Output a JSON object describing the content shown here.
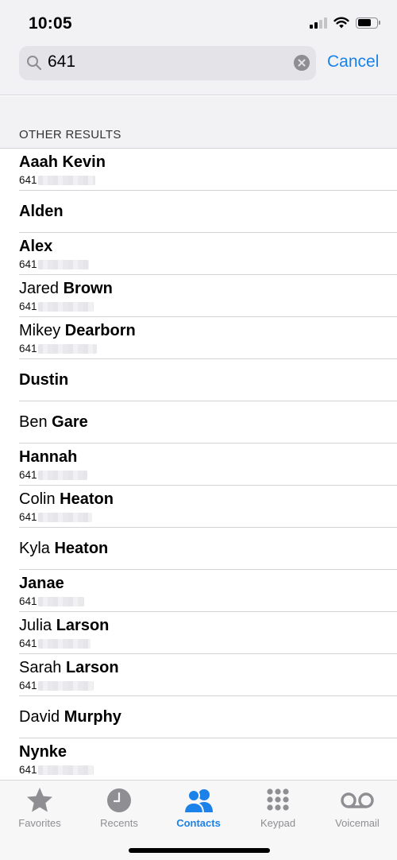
{
  "status_bar": {
    "time": "10:05",
    "icons": [
      "cellular-signal-icon",
      "wifi-icon",
      "battery-icon"
    ]
  },
  "search": {
    "query": "641",
    "cancel_label": "Cancel",
    "icon": "search-icon",
    "clear_icon": "clear-icon"
  },
  "section": {
    "header": "OTHER RESULTS"
  },
  "results": [
    {
      "first": "Aaah Kevin",
      "last": "",
      "phone_prefix": "641"
    },
    {
      "first": "Alden",
      "last": "",
      "phone_prefix": ""
    },
    {
      "first": "Alex",
      "last": "",
      "phone_prefix": "641"
    },
    {
      "first": "Jared ",
      "last": "Brown",
      "phone_prefix": "641"
    },
    {
      "first": "Mikey ",
      "last": "Dearborn",
      "phone_prefix": "641"
    },
    {
      "first": "Dustin",
      "last": "",
      "phone_prefix": ""
    },
    {
      "first": "Ben ",
      "last": "Gare",
      "phone_prefix": ""
    },
    {
      "first": "Hannah",
      "last": "",
      "phone_prefix": "641"
    },
    {
      "first": "Colin ",
      "last": "Heaton",
      "phone_prefix": "641"
    },
    {
      "first": "Kyla ",
      "last": "Heaton",
      "phone_prefix": ""
    },
    {
      "first": "Janae",
      "last": "",
      "phone_prefix": "641"
    },
    {
      "first": "Julia ",
      "last": "Larson",
      "phone_prefix": "641"
    },
    {
      "first": "Sarah ",
      "last": "Larson",
      "phone_prefix": "641"
    },
    {
      "first": "David ",
      "last": "Murphy",
      "phone_prefix": ""
    },
    {
      "first": "Nynke",
      "last": "",
      "phone_prefix": "641"
    }
  ],
  "tab_bar": {
    "tabs": [
      {
        "label": "Favorites",
        "icon": "star-icon"
      },
      {
        "label": "Recents",
        "icon": "clock-icon"
      },
      {
        "label": "Contacts",
        "icon": "contacts-icon",
        "active": true
      },
      {
        "label": "Keypad",
        "icon": "keypad-icon"
      },
      {
        "label": "Voicemail",
        "icon": "voicemail-icon"
      }
    ]
  },
  "colors": {
    "accent": "#1a82e8",
    "inactive": "#8e8e93",
    "grouped_bg": "#f2f2f4"
  }
}
